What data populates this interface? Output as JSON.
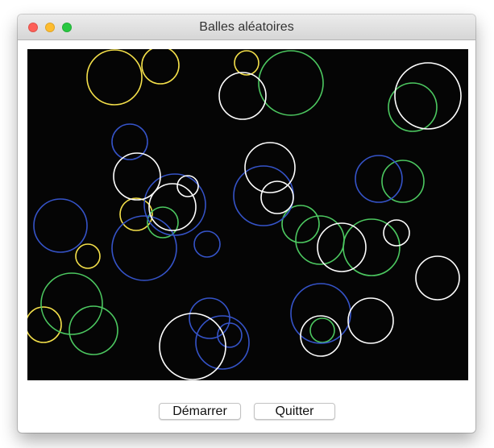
{
  "window": {
    "title": "Balles aléatoires"
  },
  "traffic_lights": {
    "close_color": "#fe5f57",
    "minimize_color": "#febc2e",
    "zoom_color": "#28c840"
  },
  "canvas": {
    "background": "#050505",
    "ball_colors": {
      "yellow": "#f4e04a",
      "green": "#4cc860",
      "white": "#ffffff",
      "blue": "#3553c8"
    }
  },
  "buttons": {
    "start_label": "Démarrer",
    "quit_label": "Quitter"
  }
}
